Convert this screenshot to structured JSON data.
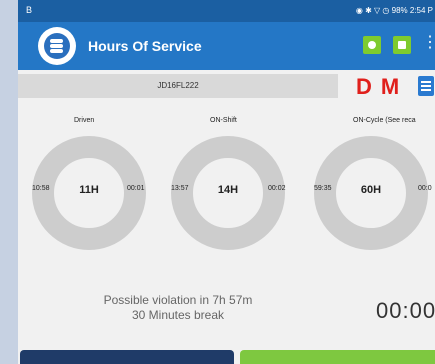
{
  "status_bar": {
    "left_text": "B",
    "right_text": "98% 2:54 P"
  },
  "app_bar": {
    "title": "Hours Of Service",
    "icons": [
      "location-icon",
      "message-icon",
      "overflow-menu-icon"
    ]
  },
  "vehicle": {
    "id": "JD16FL222"
  },
  "indicators": {
    "d": "D",
    "m": "M"
  },
  "gauges": [
    {
      "label": "Driven",
      "value": "11H",
      "left": "10:58",
      "right": "00:01",
      "fraction": 0.0
    },
    {
      "label": "ON-Shift",
      "value": "14H",
      "left": "13:57",
      "right": "00:02",
      "fraction": 0.0
    },
    {
      "label": "ON-Cycle (See reca",
      "value": "60H",
      "left": "59:35",
      "right": "00:0",
      "fraction": 0.0
    }
  ],
  "violation": {
    "line1": "Possible violation in 7h 57m",
    "line2": "30 Minutes break"
  },
  "timer": "00:00",
  "colors": {
    "status_bar": "#1b5fa2",
    "app_bar": "#2477c6",
    "ring": "#cdcdcd",
    "accent_red": "#e0201c",
    "button_dark": "#1f3b68",
    "button_green": "#7ec840"
  }
}
